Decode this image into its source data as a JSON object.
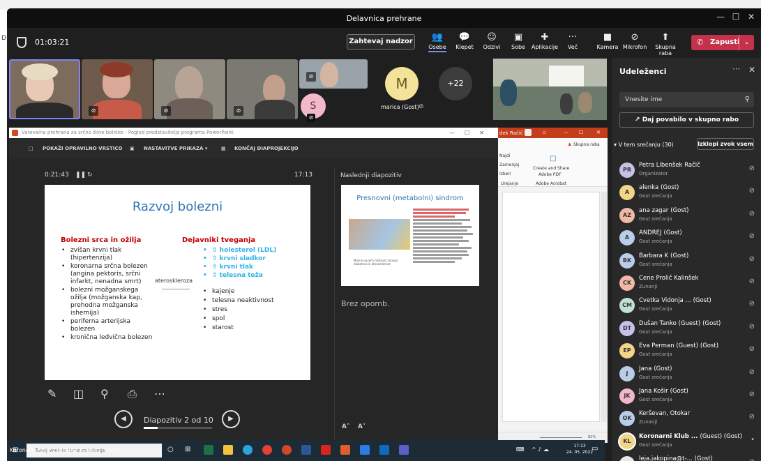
{
  "window": {
    "title": "Delavnica prehrane"
  },
  "meeting": {
    "timer": "01:03:21",
    "request_control": "Zahtevaj nadzor",
    "leave": "Zapusti"
  },
  "toolbar": [
    {
      "label": "Osebe",
      "icon": "people-icon",
      "glyph": "👥"
    },
    {
      "label": "Klepet",
      "icon": "chat-icon",
      "glyph": "💬"
    },
    {
      "label": "Odzivi",
      "icon": "reactions-icon",
      "glyph": "☺"
    },
    {
      "label": "Sobe",
      "icon": "rooms-icon",
      "glyph": "▣"
    },
    {
      "label": "Aplikacije",
      "icon": "apps-icon",
      "glyph": "✚"
    },
    {
      "label": "Več",
      "icon": "more-icon",
      "glyph": "···"
    },
    {
      "label": "Kamera",
      "icon": "camera-icon",
      "glyph": "■"
    },
    {
      "label": "Mikrofon",
      "icon": "mic-off-icon",
      "glyph": "⊘"
    },
    {
      "label": "Skupna raba",
      "icon": "share-icon",
      "glyph": "⬆"
    }
  ],
  "tiles": {
    "m_initial": "M",
    "m_name": "marica (Gost)",
    "s_initial": "S",
    "overflow": "+22"
  },
  "ppt": {
    "window_title": "Varovalna prehrana za srčno žilne bolnike - Pogled predstavitelja programa PowerPoint",
    "bar": [
      "POKAŽI OPRAVILNO VRSTICO",
      "NASTAVITVE PRIKAZA ▾",
      "KONČAJ DIAPROJEKCIJO"
    ],
    "elapsed": "0:21:43",
    "clock": "17:13",
    "next_label": "Naslednji diapozitiv",
    "notes": "Brez opomb.",
    "nav": "Diapozitiv 2 od 10",
    "progress": 0.2
  },
  "slide": {
    "title": "Razvoj bolezni",
    "left_heading": "Bolezni srca in ožilja",
    "left_items": [
      "zvišan krvni tlak (hipertenzija)",
      "koronarna srčna bolezen (angina pektoris, srčni infarkt, nenadna smrt)",
      "bolezni možganskega ožilja (možganska kap, prehodna možganska ishemija)",
      "periferna arterijska bolezen",
      "kronična ledvična bolezen"
    ],
    "middle": "ateroskleroza",
    "right_heading": "Dejavniki tveganja",
    "right_blue": [
      "⇧ holesterol (LDL)",
      "⇧ krvni sladkor",
      "⇧ krvni tlak",
      "⇧ telesna teža"
    ],
    "right_items": [
      "kajenje",
      "telesna neaktivnost",
      "stres",
      "spol",
      "starost"
    ]
  },
  "next_slide": {
    "title": "Presnovni (metabolni) sindrom",
    "caption": "Močno poveča možnost razvoja diabetesa in ateroskleroze"
  },
  "editor": {
    "user_fragment": "dek Račič",
    "share": "Skupna raba",
    "ribbon1": "Najdi",
    "ribbon2": "Zamenjaj",
    "ribbon3": "Izberi",
    "ribbon4": "Urejanje",
    "acro1": "Create and Share",
    "acro2": "Adobe PDF",
    "acro3": "Adobe Acrobat",
    "zoom": "82%"
  },
  "panel": {
    "title": "Udeleženci",
    "search_placeholder": "Vnesite ime",
    "share_invite": "Daj povabilo v skupno rabo",
    "section": "V tem srečanju (30)",
    "mute_all": "Izklopi zvok vsem",
    "people": [
      {
        "initials": "PR",
        "name": "Petra Libenšek Račič",
        "guest": "",
        "sub": "Organizator",
        "color": "#c9c0e8"
      },
      {
        "initials": "A",
        "name": "alenka",
        "guest": "(Gost)",
        "sub": "Gost srečanja",
        "color": "#f3d58a"
      },
      {
        "initials": "AZ",
        "name": "ana zagar",
        "guest": "(Gost)",
        "sub": "Gost srečanja",
        "color": "#f1b9a5"
      },
      {
        "initials": "A",
        "name": "ANDREJ",
        "guest": "(Gost)",
        "sub": "Gost srečanja",
        "color": "#b9cde8"
      },
      {
        "initials": "BK",
        "name": "Barbara K",
        "guest": "(Gost)",
        "sub": "Gost srečanja",
        "color": "#b9cde8"
      },
      {
        "initials": "CK",
        "name": "Cene Prolič Kalinšek",
        "guest": "",
        "sub": "Zunanji",
        "color": "#f1b9a5"
      },
      {
        "initials": "CM",
        "name": "Cvetka Vidonja ...",
        "guest": "(Gost)",
        "sub": "Gost srečanja",
        "color": "#bfe0d6"
      },
      {
        "initials": "DT",
        "name": "Dušan Tanko (Guest)",
        "guest": "(Gost)",
        "sub": "Gost srečanja",
        "color": "#c9c0e8"
      },
      {
        "initials": "EP",
        "name": "Eva Perman (Guest)",
        "guest": "(Gost)",
        "sub": "Gost srečanja",
        "color": "#f3d58a"
      },
      {
        "initials": "J",
        "name": "Jana",
        "guest": "(Gost)",
        "sub": "Gost srečanja",
        "color": "#b9cde8"
      },
      {
        "initials": "JK",
        "name": "Jana Košir",
        "guest": "(Gost)",
        "sub": "Gost srečanja",
        "color": "#f1b9c9"
      },
      {
        "initials": "OK",
        "name": "Kerševan, Otokar",
        "guest": "",
        "sub": "Zunanji",
        "color": "#b9cde8"
      },
      {
        "initials": "KL",
        "name": "Koronarni Klub ...",
        "guest": "(Guest) (Gost)",
        "sub": "Gost srečanja",
        "color": "#f3d58a"
      },
      {
        "initials": "L",
        "name": "leja.jakopina@t-...",
        "guest": "(Gost)",
        "sub": "",
        "color": "#e8e8e8"
      }
    ]
  },
  "taskbar": {
    "search": "Tukaj vnesite izraz za iskanje",
    "time": "17:13",
    "date": "24. 05. 2022",
    "user": "Koronarni Klub Ljubljana (Guest) (Gost)"
  }
}
